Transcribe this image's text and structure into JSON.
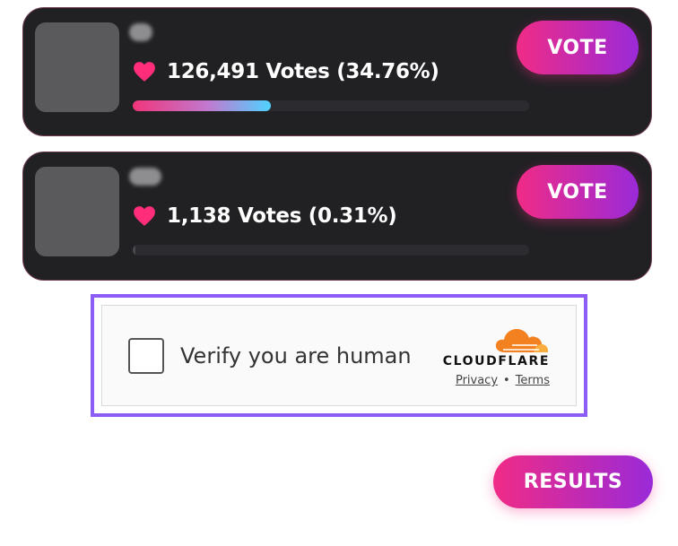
{
  "candidates": [
    {
      "votes_text": "126,491 Votes (34.76%)",
      "share_fraction": 0.3476,
      "vote_label": "VOTE"
    },
    {
      "votes_text": "1,138 Votes (0.31%)",
      "share_fraction": 0.0031,
      "vote_label": "VOTE"
    }
  ],
  "captcha": {
    "label": "Verify you are human",
    "brand": "CLOUDFLARE",
    "privacy_link": "Privacy",
    "separator": "•",
    "terms_link": "Terms",
    "frame_color": "#8b5cf6",
    "logo_icon": "cloudflare-cloud-icon"
  },
  "results_label": "RESULTS",
  "colors": {
    "card_bg": "#212124",
    "accent_pink": "#f02b86",
    "accent_purple": "#9a2ad8",
    "heart": "#ff2d7a",
    "cloudflare_orange": "#f48120"
  }
}
